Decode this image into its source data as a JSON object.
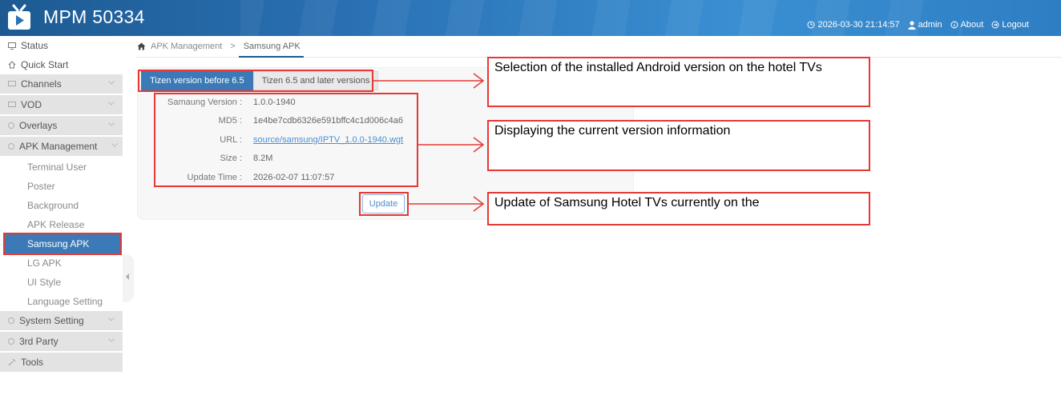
{
  "app": {
    "title": "MPM 50334"
  },
  "header": {
    "datetime": "2026-03-30 21:14:57",
    "user": "admin",
    "about": "About",
    "logout": "Logout"
  },
  "sidebar": {
    "status": "Status",
    "quick_start": "Quick Start",
    "groups": {
      "channels": "Channels",
      "vod": "VOD",
      "overlays": "Overlays",
      "apk_management": "APK Management",
      "system_setting": "System Setting",
      "third_party": "3rd Party"
    },
    "apk_items": [
      "Terminal User",
      "Poster",
      "Background",
      "APK Release",
      "Samsung APK",
      "LG APK",
      "UI Style",
      "Language Setting"
    ],
    "tools": "Tools"
  },
  "breadcrumb": {
    "parent": "APK Management",
    "separator": ">",
    "current": "Samsung APK"
  },
  "tabs": [
    "Tizen version before 6.5",
    "Tizen 6.5 and later versions"
  ],
  "info": {
    "labels": {
      "version": "Samaung Version :",
      "md5": "MD5 :",
      "url": "URL :",
      "size": "Size :",
      "update_time": "Update Time :"
    },
    "values": {
      "version": "1.0.0-1940",
      "md5": "1e4be7cdb6326e591bffc4c1d006c4a6",
      "url": "source/samsung/IPTV_1.0.0-1940.wgt",
      "size": "8.2M",
      "update_time": "2026-02-07 11:07:57"
    }
  },
  "update_button": "Update",
  "annotations": {
    "tabs_note": "Selection of the installed Android version on the hotel TVs",
    "info_note": "Displaying the current version information",
    "update_note": "Update of Samsung Hotel TVs currently on the"
  },
  "colors": {
    "header": "#2a72b5",
    "active": "#3b7ab6",
    "highlight": "#e53935",
    "link": "#4a8fd4"
  }
}
